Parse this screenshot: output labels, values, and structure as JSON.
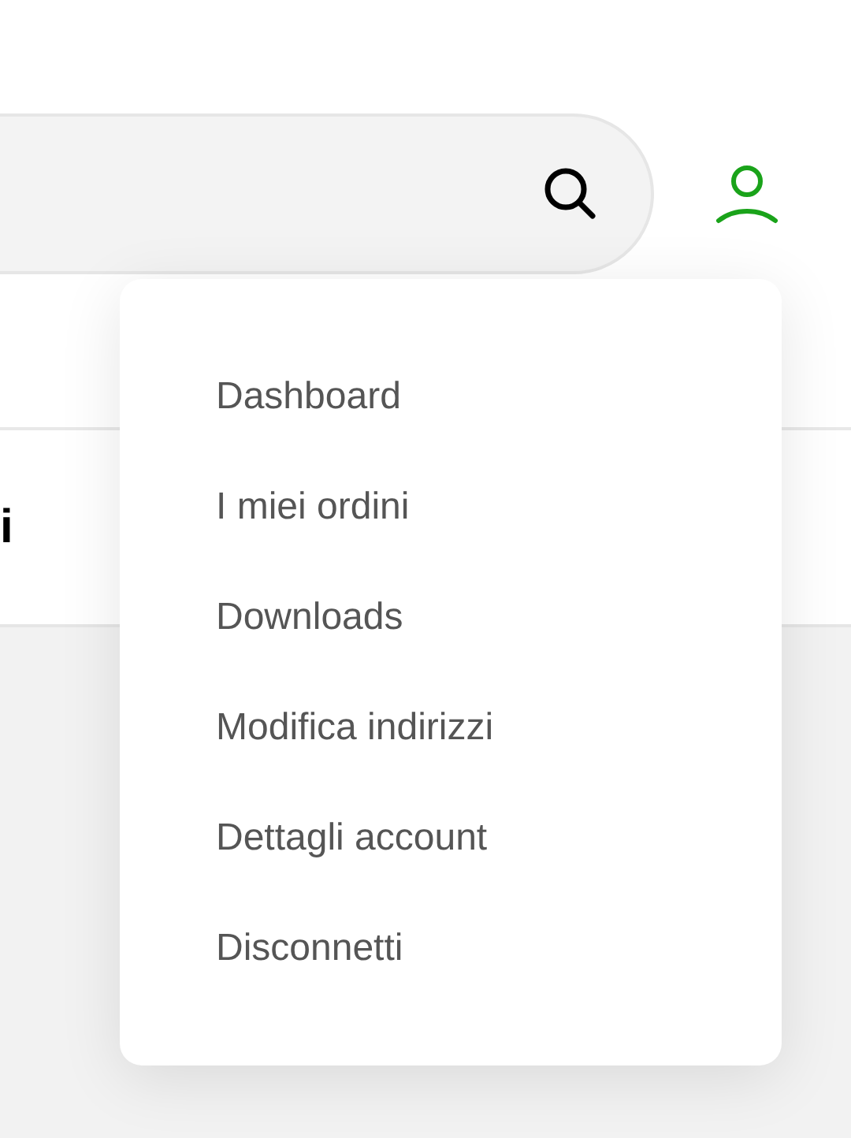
{
  "page": {
    "heading_fragment": "i"
  },
  "account_menu": {
    "items": [
      {
        "label": "Dashboard"
      },
      {
        "label": "I miei ordini"
      },
      {
        "label": "Downloads"
      },
      {
        "label": "Modifica indirizzi"
      },
      {
        "label": "Dettagli account"
      },
      {
        "label": "Disconnetti"
      }
    ]
  }
}
